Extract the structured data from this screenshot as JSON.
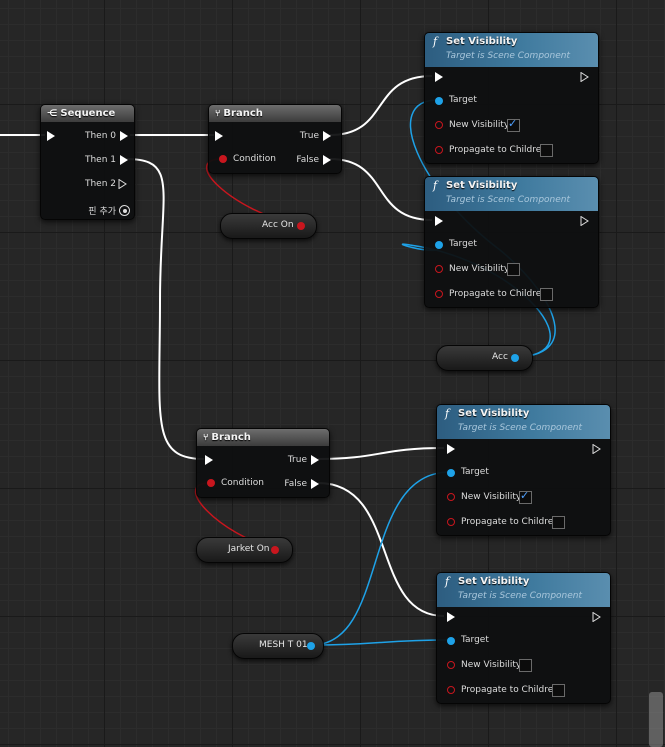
{
  "sequence": {
    "title": "Sequence",
    "outputs": [
      "Then 0",
      "Then 1",
      "Then 2"
    ],
    "add_pin": "핀 추가"
  },
  "branch_top": {
    "title": "Branch",
    "true_label": "True",
    "false_label": "False",
    "condition_label": "Condition"
  },
  "branch_bottom": {
    "title": "Branch",
    "true_label": "True",
    "false_label": "False",
    "condition_label": "Condition"
  },
  "set_visibility": {
    "title": "Set Visibility",
    "subtitle": "Target is Scene Component",
    "target_label": "Target",
    "new_visibility_label": "New Visibility",
    "propagate_label": "Propagate to Children",
    "icon": "f"
  },
  "set_visibility_nodes": [
    {
      "new_visibility": true,
      "propagate": false
    },
    {
      "new_visibility": false,
      "propagate": false
    },
    {
      "new_visibility": true,
      "propagate": false
    },
    {
      "new_visibility": false,
      "propagate": false
    }
  ],
  "variables": {
    "acc_on": "Acc On",
    "acc": "Acc",
    "jarket_on": "Jarket On",
    "mesh": "MESH T 01"
  },
  "colors": {
    "exec": "#ffffff",
    "bool": "#c8161e",
    "object": "#1ea2e8",
    "function_header": "#3f7a9e"
  }
}
